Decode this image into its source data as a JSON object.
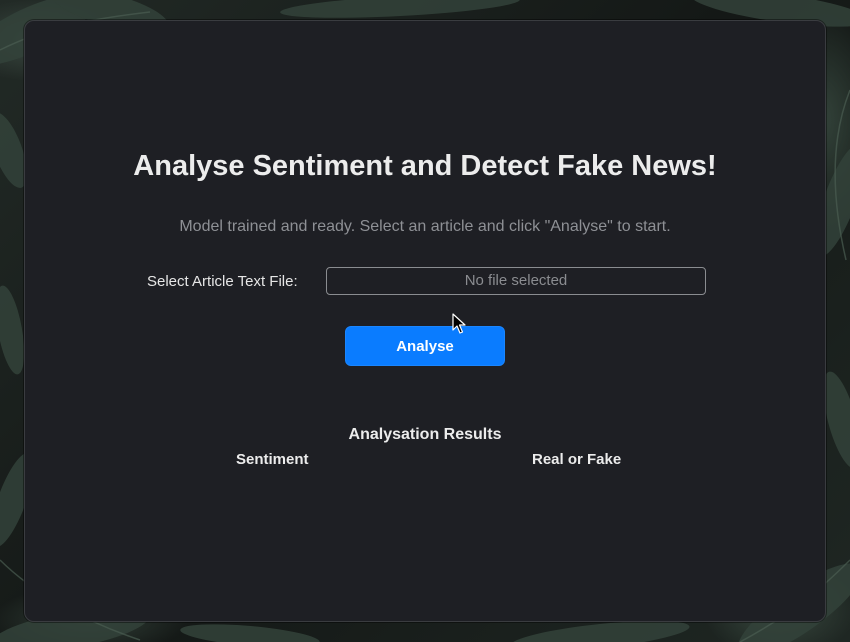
{
  "header": {
    "title": "Analyse Sentiment and Detect Fake News!"
  },
  "status": {
    "message": "Model trained and ready. Select an article and click \"Analyse\" to start."
  },
  "file_picker": {
    "label": "Select Article Text File:",
    "value": "No file selected"
  },
  "actions": {
    "analyse_label": "Analyse"
  },
  "results": {
    "title": "Analysation Results",
    "columns": [
      "Sentiment",
      "Real or Fake"
    ]
  },
  "colors": {
    "accent": "#0a7cff",
    "card_background": "#1e1f24",
    "text_primary": "#ececec",
    "text_muted": "#8e9095"
  },
  "icons": {
    "pointer": "mouse-pointer-icon"
  }
}
